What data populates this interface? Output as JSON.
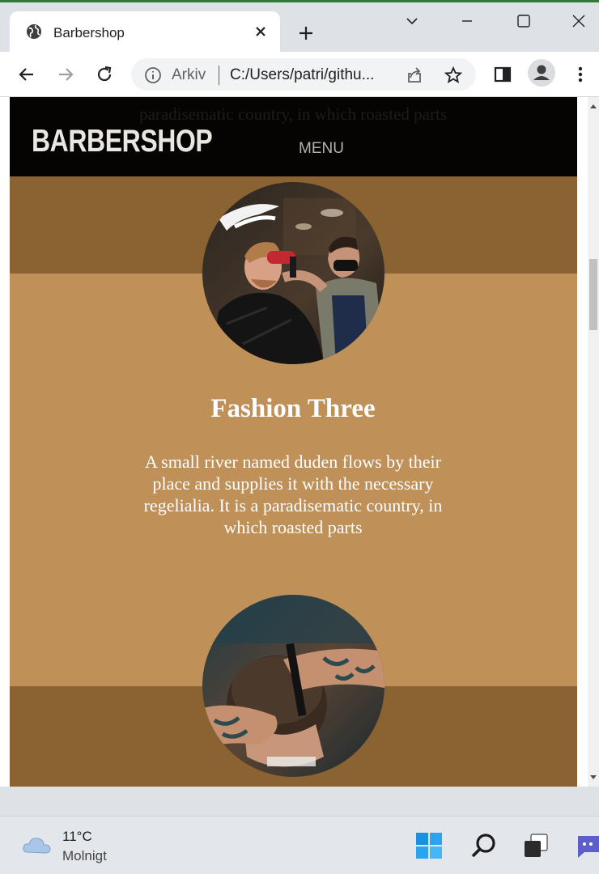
{
  "browser": {
    "tab": {
      "title": "Barbershop"
    },
    "omnibox": {
      "chip": "Arkiv",
      "url": "C:/Users/patri/githu..."
    }
  },
  "page": {
    "brand": "BARBERSHOP",
    "menu_label": "MENU",
    "behind_nav_text": "paradisematic country, in which roasted parts",
    "colors": {
      "tan": "#bf9058",
      "brown": "#8b6232",
      "nav": "#050403"
    },
    "card": {
      "title": "Fashion Three",
      "text": "A small river named duden flows by their place and supplies it with the necessary regelialia. It is a paradisematic country, in which roasted parts"
    }
  },
  "taskbar": {
    "weather": {
      "temperature": "11°C",
      "condition": "Molnigt",
      "icon": "cloud-icon"
    }
  }
}
